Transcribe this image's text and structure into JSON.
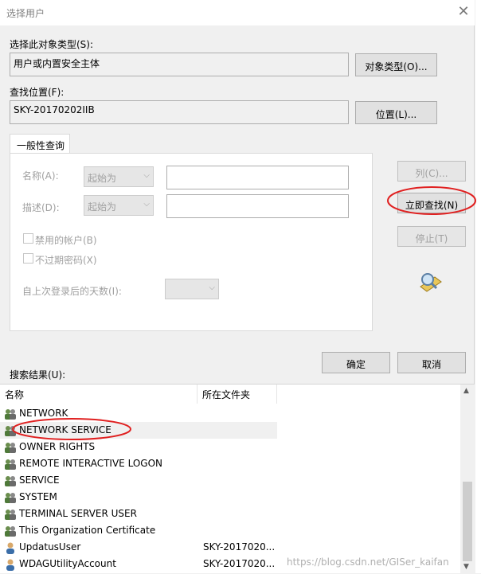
{
  "title": "选择用户",
  "object_type": {
    "label": "选择此对象类型(S):",
    "value": "用户或内置安全主体",
    "button": "对象类型(O)..."
  },
  "location": {
    "label": "查找位置(F):",
    "value": "SKY-20170202IIB",
    "button": "位置(L)..."
  },
  "query": {
    "tab": "一般性查询",
    "name_label": "名称(A):",
    "name_mode": "起始为",
    "desc_label": "描述(D):",
    "desc_mode": "起始为",
    "disabled_accounts": "禁用的帐户(B)",
    "non_expiring": "不过期密码(X)",
    "days_label": "自上次登录后的天数(I):"
  },
  "side_buttons": {
    "columns": "列(C)...",
    "find_now": "立即查找(N)",
    "stop": "停止(T)"
  },
  "ok": "确定",
  "cancel": "取消",
  "results": {
    "label": "搜索结果(U):",
    "col_name": "名称",
    "col_folder": "所在文件夹",
    "rows": [
      {
        "name": "NETWORK",
        "folder": ""
      },
      {
        "name": "NETWORK SERVICE",
        "folder": ""
      },
      {
        "name": "OWNER RIGHTS",
        "folder": ""
      },
      {
        "name": "REMOTE INTERACTIVE LOGON",
        "folder": ""
      },
      {
        "name": "SERVICE",
        "folder": ""
      },
      {
        "name": "SYSTEM",
        "folder": ""
      },
      {
        "name": "TERMINAL SERVER USER",
        "folder": ""
      },
      {
        "name": "This Organization Certificate",
        "folder": ""
      },
      {
        "name": "UpdatusUser",
        "folder": "SKY-2017020..."
      },
      {
        "name": "WDAGUtilityAccount",
        "folder": "SKY-2017020..."
      }
    ]
  },
  "watermark": "https://blog.csdn.net/GISer_kaifan",
  "colors": {
    "annotation": "#e02020",
    "selected_row": "#f0f0f0"
  },
  "icons": {
    "group": "users-group-icon",
    "user": "user-icon",
    "search": "search-flashlight-icon"
  }
}
